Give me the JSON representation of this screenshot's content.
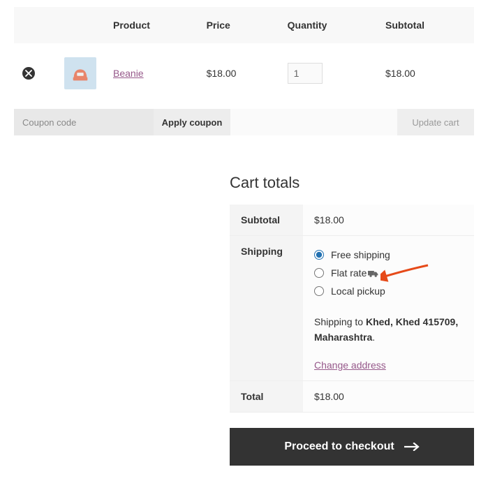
{
  "cart_table": {
    "headers": {
      "product": "Product",
      "price": "Price",
      "quantity": "Quantity",
      "subtotal": "Subtotal"
    },
    "items": [
      {
        "name": "Beanie",
        "price": "$18.00",
        "quantity": "1",
        "subtotal": "$18.00"
      }
    ]
  },
  "actions": {
    "coupon_placeholder": "Coupon code",
    "apply_coupon_label": "Apply coupon",
    "update_cart_label": "Update cart"
  },
  "cart_totals": {
    "title": "Cart totals",
    "subtotal_label": "Subtotal",
    "subtotal_value": "$18.00",
    "shipping_label": "Shipping",
    "shipping_options": [
      {
        "label": "Free shipping",
        "selected": true,
        "icon": null
      },
      {
        "label": "Flat rate",
        "selected": false,
        "icon": "truck"
      },
      {
        "label": "Local pickup",
        "selected": false,
        "icon": null
      }
    ],
    "shipping_to_prefix": "Shipping to ",
    "shipping_to_address": "Khed, Khed 415709, Maharashtra",
    "change_address_label": "Change address",
    "total_label": "Total",
    "total_value": "$18.00",
    "checkout_label": "Proceed to checkout"
  }
}
